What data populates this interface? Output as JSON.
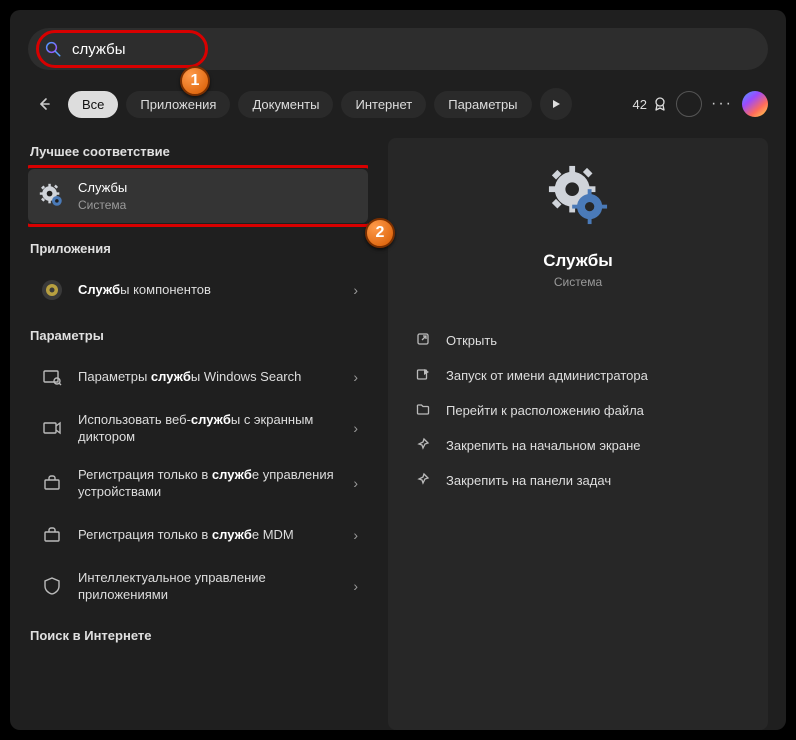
{
  "search": {
    "value": "службы"
  },
  "filters": {
    "items": [
      "Все",
      "Приложения",
      "Документы",
      "Интернет",
      "Параметры"
    ],
    "points": "42"
  },
  "left": {
    "best_match_h": "Лучшее соответствие",
    "best": {
      "title": "Службы",
      "sub": "Система"
    },
    "apps_h": "Приложения",
    "app1_pre": "",
    "app1_b": "Служб",
    "app1_post": "ы компонентов",
    "params_h": "Параметры",
    "p1_pre": "Параметры ",
    "p1_b": "служб",
    "p1_post": "ы Windows Search",
    "p2_pre": "Использовать веб-",
    "p2_b": "служб",
    "p2_post": "ы с экранным диктором",
    "p3_pre": "Регистрация только в ",
    "p3_b": "служб",
    "p3_post": "е управления устройствами",
    "p4_pre": "Регистрация только в ",
    "p4_b": "служб",
    "p4_post": "е MDM",
    "p5": "Интеллектуальное управление приложениями",
    "web_h": "Поиск в Интернете"
  },
  "preview": {
    "title": "Службы",
    "sub": "Система",
    "a1": "Открыть",
    "a2": "Запуск от имени администратора",
    "a3": "Перейти к расположению файла",
    "a4": "Закрепить на начальном экране",
    "a5": "Закрепить на панели задач"
  },
  "badges": {
    "b1": "1",
    "b2": "2"
  }
}
